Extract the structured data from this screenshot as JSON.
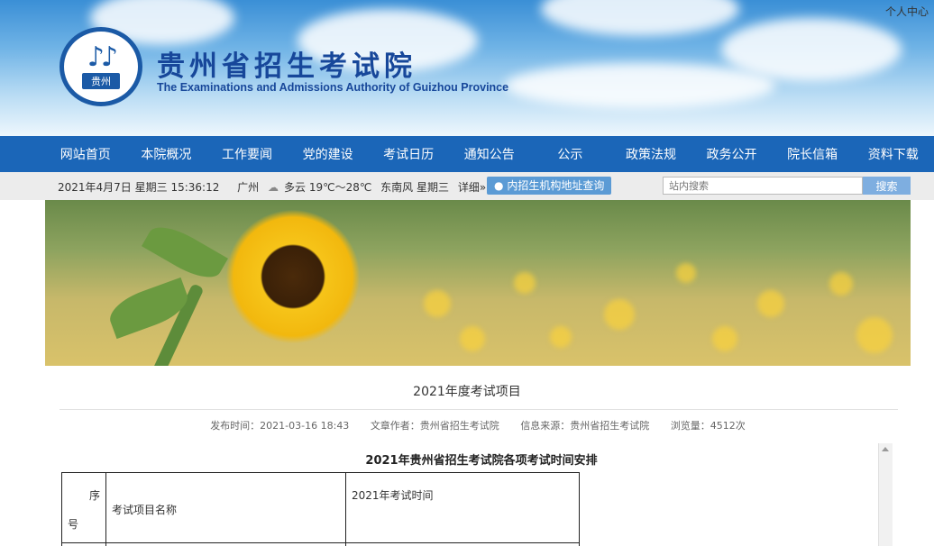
{
  "header": {
    "title_cn": "贵州省招生考试院",
    "title_en": "The Examinations and Admissions Authority of Guizhou Province",
    "logo_text": "贵州",
    "personal_center": "个人中心"
  },
  "nav": {
    "items": [
      "网站首页",
      "本院概况",
      "工作要闻",
      "党的建设",
      "考试日历",
      "通知公告",
      "公示",
      "政策法规",
      "政务公开",
      "院长信箱",
      "资料下载"
    ]
  },
  "infobar": {
    "datetime": "2021年4月7日  星期三  15:36:12",
    "city": "广州",
    "weather": "多云 19℃～28℃",
    "wind": "东南风 星期三",
    "detail_link": "详细»",
    "locate_button": "内招生机构地址查询",
    "search_placeholder": "站内搜索",
    "search_button": "搜索"
  },
  "article": {
    "title": "2021年度考试项目",
    "publish_time": "发布时间：2021-03-16 18:43",
    "author": "文章作者：贵州省招生考试院",
    "source": "信息来源：贵州省招生考试院",
    "views": "浏览量：4512次",
    "content_title": "2021年贵州省招生考试院各项考试时间安排",
    "table": {
      "header_index_top": "序",
      "header_index_bottom": "号",
      "header_name": "考试项目名称",
      "header_time": "2021年考试时间"
    }
  }
}
